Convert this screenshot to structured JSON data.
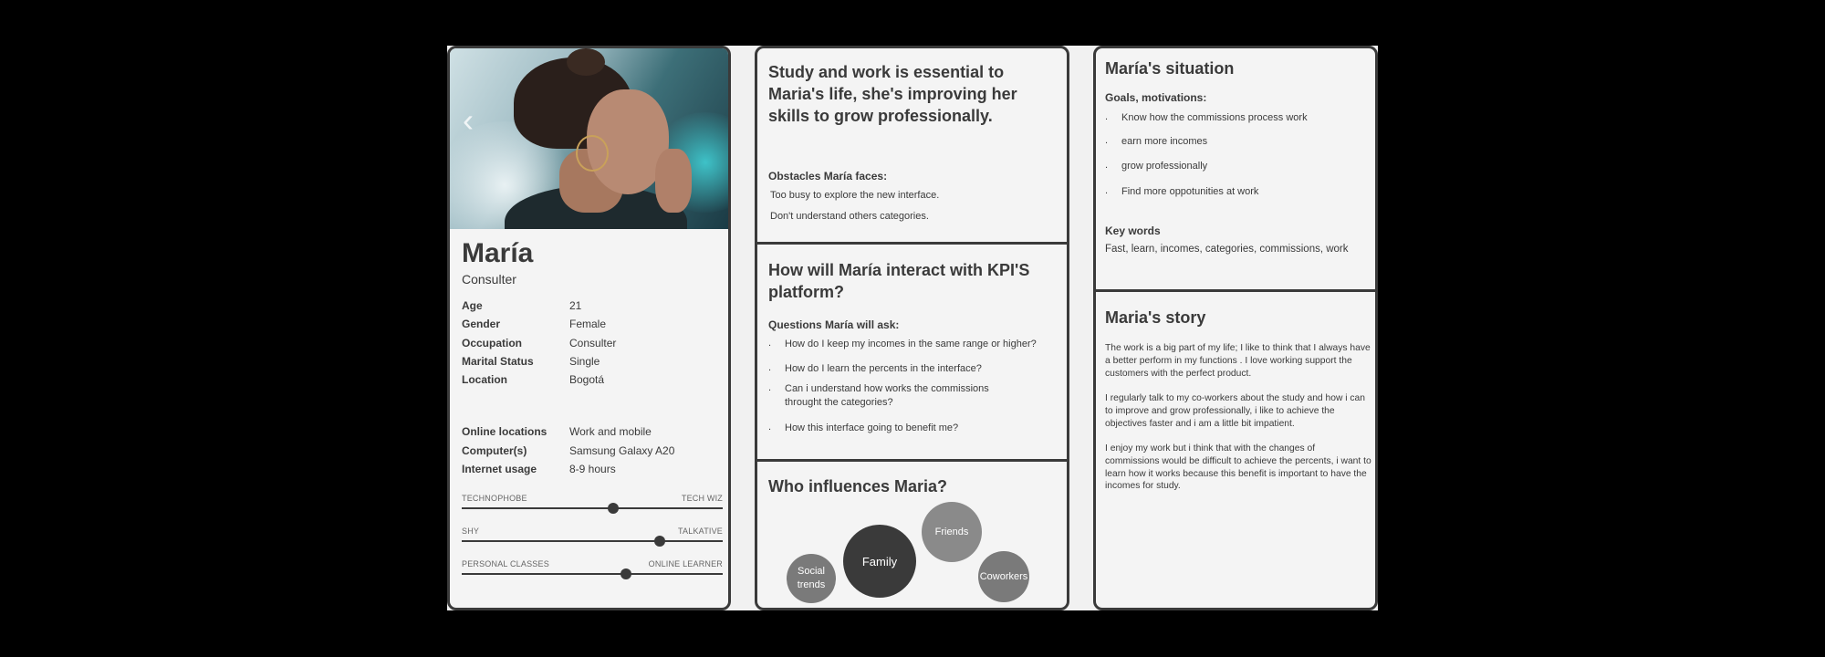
{
  "persona": {
    "name": "María",
    "role": "Consulter",
    "details": [
      {
        "label": "Age",
        "value": "21"
      },
      {
        "label": "Gender",
        "value": "Female"
      },
      {
        "label": "Occupation",
        "value": "Consulter"
      },
      {
        "label": "Marital Status",
        "value": "Single"
      },
      {
        "label": "Location",
        "value": "Bogotá"
      }
    ],
    "tech": [
      {
        "label": "Online locations",
        "value": "Work and mobile"
      },
      {
        "label": "Computer(s)",
        "value": "Samsung Galaxy A20"
      },
      {
        "label": "Internet usage",
        "value": "8-9 hours"
      }
    ],
    "sliders": [
      {
        "left": "TECHNOPHOBE",
        "right": "TECH WIZ",
        "level": 0.58
      },
      {
        "left": "SHY",
        "right": "TALKATIVE",
        "level": 0.76
      },
      {
        "left": "PERSONAL CLASSES",
        "right": "ONLINE LEARNER",
        "level": 0.63
      }
    ]
  },
  "quote": {
    "headline": "Study and work is essential to Maria's life, she's improving her skills to grow professionally.",
    "obstacles_title": "Obstacles María faces:",
    "obstacles": [
      "Too busy to explore the new interface.",
      "Don't understand others categories."
    ]
  },
  "interaction": {
    "title": "How will María interact with KPI'S platform?",
    "questions_title": "Questions María will ask:",
    "questions": [
      "How do I keep my incomes in the same range or higher?",
      "How do I learn the percents in the interface?",
      "Can i understand how works the commissions throught the categories?",
      "How this interface going to benefit me?"
    ]
  },
  "influences": {
    "title": "Who influences Maria?",
    "bubbles": [
      {
        "label": "Social trends",
        "color": "#7a7a7a"
      },
      {
        "label": "Family",
        "color": "#3a3a3a"
      },
      {
        "label": "Friends",
        "color": "#8a8a8a"
      },
      {
        "label": "Coworkers",
        "color": "#7a7a7a"
      }
    ]
  },
  "situation": {
    "title": "María's situation",
    "goals_title": "Goals, motivations:",
    "goals": [
      "Know how the commissions process work",
      "earn more incomes",
      "grow professionally",
      "Find more oppotunities at work"
    ],
    "keywords_title": "Key words",
    "keywords": "Fast, learn, incomes, categories, commissions, work"
  },
  "story": {
    "title": "Maria's story",
    "paragraphs": [
      "The work is a big part of my life; I like to think that I always have a better perform in my functions . I love working support the customers with the perfect product.",
      "I regularly talk to my co-workers about the study and how i can to improve and grow professionally, i like to achieve the objectives faster and i am a little bit impatient.",
      "I enjoy my work but i think that with the changes of commissions would be difficult to achieve the percents, i want to learn how it works because this benefit is important to have the incomes for study."
    ]
  },
  "colors": {
    "ink": "#3a3a3a",
    "panel": "#f4f4f4",
    "background": "#000000"
  },
  "icons": {
    "photo_nav": "chevron-left-icon"
  }
}
